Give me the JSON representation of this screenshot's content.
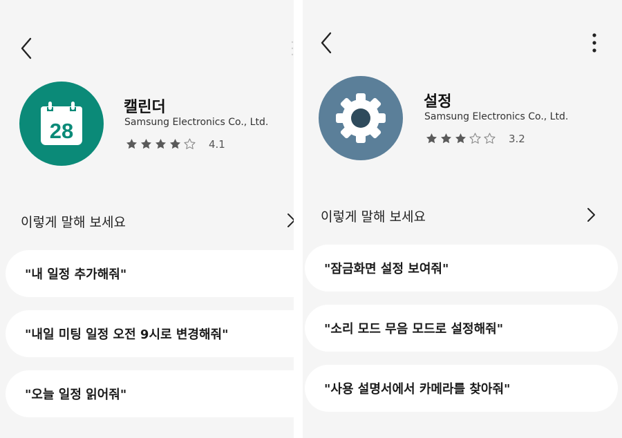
{
  "colors": {
    "background": "#f5f5f5",
    "card": "#ffffff",
    "calendar_icon_bg": "#0b8a78",
    "settings_icon_bg": "#5b7f99",
    "star_filled": "#5a5a5a",
    "star_empty": "#888888"
  },
  "screens": [
    {
      "app_name": "캘린더",
      "publisher": "Samsung Electronics Co., Ltd.",
      "rating": "4.1",
      "stars_filled": 4,
      "stars_total": 5,
      "icon": "calendar-icon",
      "icon_text": "28",
      "section_title": "이렇게 말해 보세요",
      "utterances": [
        "\"내 일정 추가해줘\"",
        "\"내일 미팅 일정 오전 9시로 변경해줘\"",
        "\"오늘 일정 읽어줘\""
      ]
    },
    {
      "app_name": "설정",
      "publisher": "Samsung Electronics Co., Ltd.",
      "rating": "3.2",
      "stars_filled": 3,
      "stars_total": 5,
      "icon": "gear-icon",
      "section_title": "이렇게 말해 보세요",
      "utterances": [
        "\"잠금화면 설정 보여줘\"",
        "\"소리 모드 무음 모드로 설정해줘\"",
        "\"사용 설명서에서 카메라를 찾아줘\""
      ]
    }
  ]
}
